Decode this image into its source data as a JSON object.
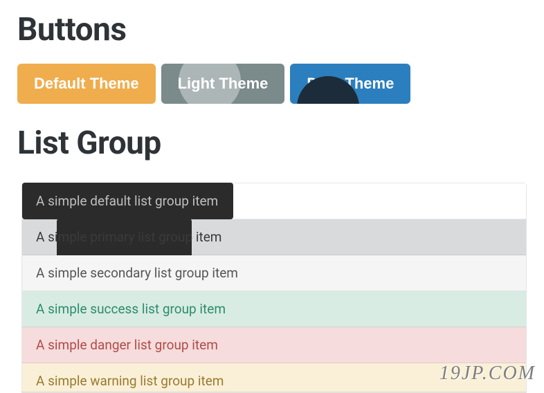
{
  "headings": {
    "buttons": "Buttons",
    "listgroup": "List Group"
  },
  "buttons": {
    "default": "Default Theme",
    "light": "Light Theme",
    "dark": "Dark Theme"
  },
  "list": {
    "default": "A simple default list group item",
    "primary": "A simple primary list group item",
    "secondary": "A simple secondary list group item",
    "success": "A simple success list group item",
    "danger": "A simple danger list group item",
    "warning": "A simple warning list group item"
  },
  "watermark": "19JP.COM"
}
